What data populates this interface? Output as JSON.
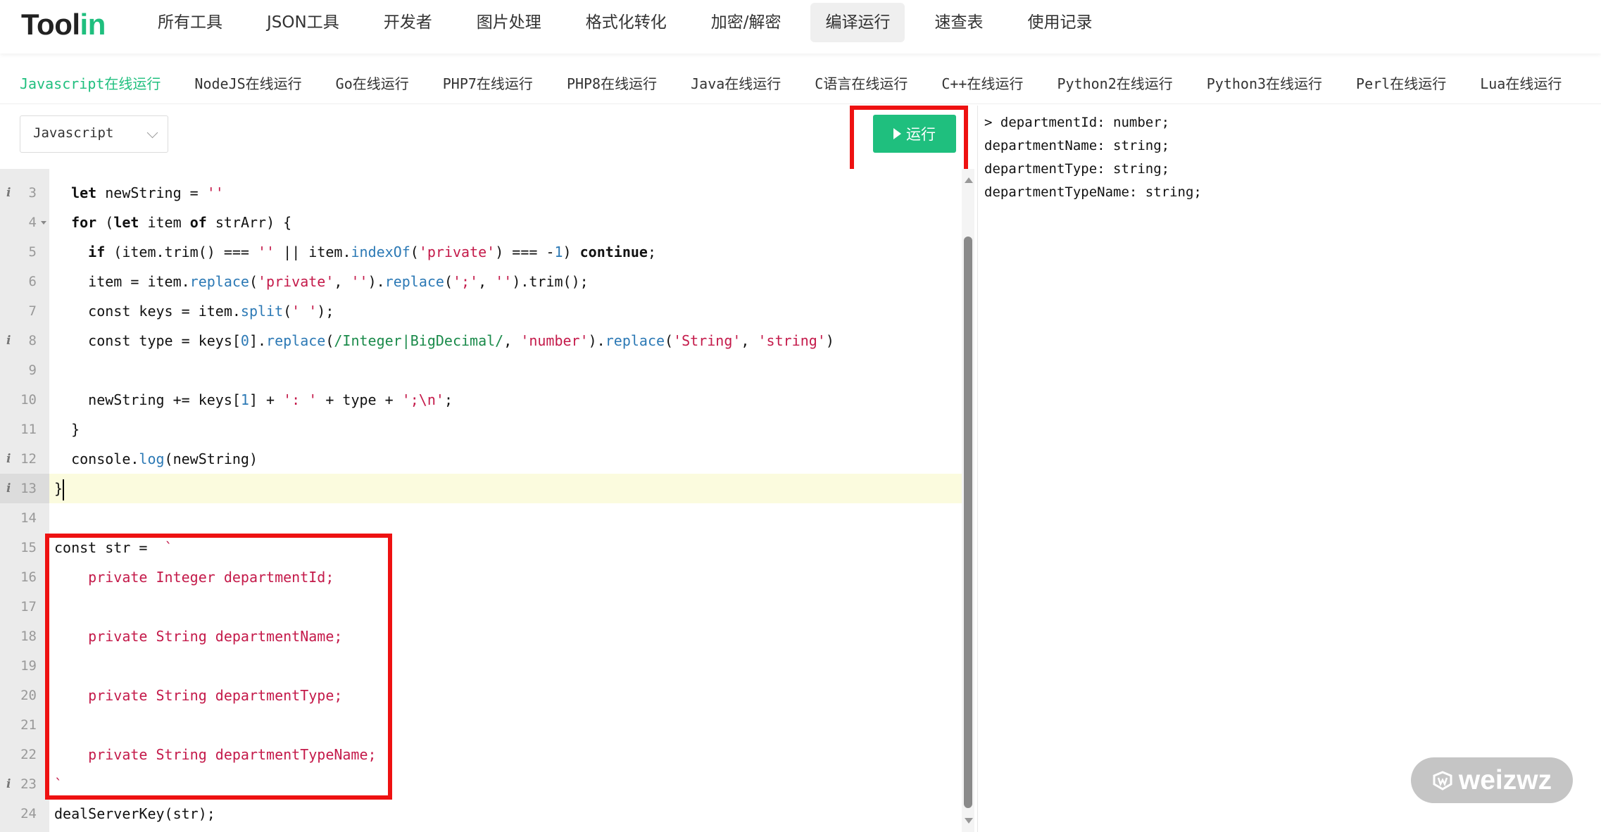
{
  "brand": {
    "logo_part1": "Tool",
    "logo_part2": "in"
  },
  "top_nav": {
    "items": [
      "所有工具",
      "JSON工具",
      "开发者",
      "图片处理",
      "格式化转化",
      "加密/解密",
      "编译运行",
      "速查表",
      "使用记录"
    ],
    "active_index": 6
  },
  "sub_nav": {
    "items": [
      "Javascript在线运行",
      "NodeJS在线运行",
      "Go在线运行",
      "PHP7在线运行",
      "PHP8在线运行",
      "Java在线运行",
      "C语言在线运行",
      "C++在线运行",
      "Python2在线运行",
      "Python3在线运行",
      "Perl在线运行",
      "Lua在线运行"
    ],
    "active_index": 0
  },
  "toolbar": {
    "language": "Javascript",
    "run_label": "运行"
  },
  "editor": {
    "lines": [
      {
        "n": "3",
        "ann": "i",
        "fold": false,
        "html": "  <span class=\"kw\">let</span> newString = <span class=\"str\">''</span>"
      },
      {
        "n": "4",
        "ann": "",
        "fold": true,
        "html": "  <span class=\"kw\">for</span> (<span class=\"kw\">let</span> item <span class=\"kw\">of</span> strArr) {"
      },
      {
        "n": "5",
        "ann": "",
        "fold": false,
        "html": "    <span class=\"kw\">if</span> (item.trim() === <span class=\"str\">''</span> || item.<span class=\"fn\">indexOf</span>(<span class=\"str\">'private'</span>) === -<span class=\"num\">1</span>) <span class=\"kw\">continue</span>;"
      },
      {
        "n": "6",
        "ann": "",
        "fold": false,
        "html": "    item = item.<span class=\"fn\">replace</span>(<span class=\"str\">'private'</span>, <span class=\"str\">''</span>).<span class=\"fn\">replace</span>(<span class=\"str\">';'</span>, <span class=\"str\">''</span>).trim();"
      },
      {
        "n": "7",
        "ann": "",
        "fold": false,
        "html": "    const keys = item.<span class=\"fn\">split</span>(<span class=\"str\">' '</span>);"
      },
      {
        "n": "8",
        "ann": "i",
        "fold": false,
        "html": "    const type = keys[<span class=\"num\">0</span>].<span class=\"fn\">replace</span>(<span class=\"rx\">/Integer|BigDecimal/</span>, <span class=\"str\">'number'</span>).<span class=\"fn\">replace</span>(<span class=\"str\">'String'</span>, <span class=\"str\">'string'</span>)"
      },
      {
        "n": "9",
        "ann": "",
        "fold": false,
        "html": ""
      },
      {
        "n": "10",
        "ann": "",
        "fold": false,
        "html": "    newString += keys[<span class=\"num\">1</span>] + <span class=\"str\">': '</span> + type + <span class=\"str\">';\\n'</span>;"
      },
      {
        "n": "11",
        "ann": "",
        "fold": false,
        "html": "  }"
      },
      {
        "n": "12",
        "ann": "i",
        "fold": false,
        "html": "  console.<span class=\"fn\">log</span>(newString)"
      },
      {
        "n": "13",
        "ann": "i",
        "fold": false,
        "current": true,
        "html": "}<span class=\"cursor\"></span>"
      },
      {
        "n": "14",
        "ann": "",
        "fold": false,
        "html": ""
      },
      {
        "n": "15",
        "ann": "",
        "fold": false,
        "html": "const str =  <span class=\"str\">`</span>"
      },
      {
        "n": "16",
        "ann": "",
        "fold": false,
        "html": "<span class=\"str\">    private Integer departmentId;</span>"
      },
      {
        "n": "17",
        "ann": "",
        "fold": false,
        "html": ""
      },
      {
        "n": "18",
        "ann": "",
        "fold": false,
        "html": "<span class=\"str\">    private String departmentName;</span>"
      },
      {
        "n": "19",
        "ann": "",
        "fold": false,
        "html": ""
      },
      {
        "n": "20",
        "ann": "",
        "fold": false,
        "html": "<span class=\"str\">    private String departmentType;</span>"
      },
      {
        "n": "21",
        "ann": "",
        "fold": false,
        "html": ""
      },
      {
        "n": "22",
        "ann": "",
        "fold": false,
        "html": "<span class=\"str\">    private String departmentTypeName;</span>"
      },
      {
        "n": "23",
        "ann": "i",
        "fold": false,
        "html": "<span class=\"str\">`</span>"
      },
      {
        "n": "24",
        "ann": "",
        "fold": false,
        "html": "dealServerKey(str);"
      }
    ]
  },
  "output": {
    "lines": [
      "> departmentId: number;",
      "departmentName: string;",
      "departmentType: string;",
      "departmentTypeName: string;"
    ]
  },
  "watermark": {
    "text": "weizwz"
  },
  "colors": {
    "accent": "#1fbf7e",
    "highlight_box": "#ee1111",
    "current_line": "#fbfbde"
  }
}
